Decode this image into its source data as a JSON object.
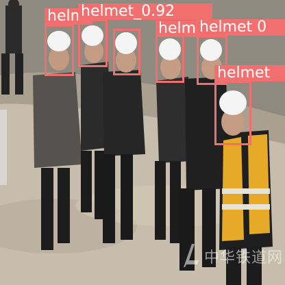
{
  "image": {
    "description_colors": {
      "ground": "#c9bfae",
      "slope": "#8f8b80",
      "box": "#f26f6f",
      "label_text": "#ffffff"
    }
  },
  "detections": [
    {
      "label": "helmet",
      "score_text": ""
    },
    {
      "label": "helmet_0.92",
      "score_text": "0.92"
    },
    {
      "label": "helmet",
      "score_text": ""
    },
    {
      "label": "helmet",
      "score_text": ""
    },
    {
      "label": "helmet 0",
      "score_text": ""
    },
    {
      "label": "helmet",
      "score_text": ""
    }
  ],
  "watermark": {
    "text": "中华铁道网",
    "icon": "rail-logo-icon"
  }
}
